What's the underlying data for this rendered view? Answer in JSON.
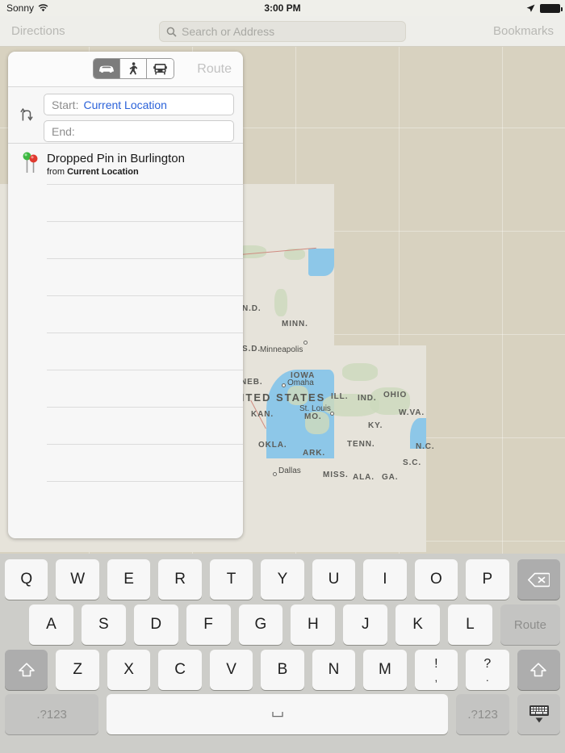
{
  "status_bar": {
    "carrier": "Sonny",
    "wifi_icon": "wifi-icon",
    "time": "3:00 PM",
    "location_icon": "location-arrow-icon",
    "battery_icon": "battery-full-icon"
  },
  "navbar": {
    "directions_label": "Directions",
    "bookmarks_label": "Bookmarks",
    "search_placeholder": "Search or Address",
    "search_value": "",
    "search_icon": "search-icon"
  },
  "panel": {
    "route_label": "Route",
    "modes": [
      {
        "name": "drive-mode",
        "icon": "car-icon",
        "selected": true
      },
      {
        "name": "walk-mode",
        "icon": "walking-icon",
        "selected": false
      },
      {
        "name": "transit-mode",
        "icon": "bus-icon",
        "selected": false
      }
    ],
    "swap_icon": "swap-arrows-icon",
    "start_field": {
      "label": "Start:",
      "value": "Current Location",
      "placeholder": ""
    },
    "end_field": {
      "label": "End:",
      "value": "",
      "placeholder": ""
    },
    "recents": [
      {
        "title": "Dropped Pin in Burlington",
        "sub_prefix": "from ",
        "sub_bold": "Current Location",
        "icon": "map-pins-icon"
      }
    ],
    "empty_row_count": 8
  },
  "map": {
    "base_color": "#d8d2c0",
    "land_color": "#e6e3da",
    "water_color": "#8dc7e8",
    "country_label": "UNITED STATES",
    "state_labels": [
      "N.D.",
      "S.D.",
      "MINN.",
      "NEB.",
      "IOWA",
      "ILL.",
      "IND.",
      "OHIO",
      "KAN.",
      "MO.",
      "KY.",
      "W.VA.",
      "OKLA.",
      "ARK.",
      "TENN.",
      "N.C.",
      "S.C.",
      "MISS.",
      "ALA.",
      "GA."
    ],
    "city_labels": [
      "Minneapolis",
      "Omaha",
      "St. Louis",
      "Dallas"
    ]
  },
  "keyboard": {
    "row1": [
      "Q",
      "W",
      "E",
      "R",
      "T",
      "Y",
      "U",
      "I",
      "O",
      "P"
    ],
    "backspace_icon": "backspace-icon",
    "row2": [
      "A",
      "S",
      "D",
      "F",
      "G",
      "H",
      "J",
      "K",
      "L"
    ],
    "return_label": "Route",
    "row3": [
      "Z",
      "X",
      "C",
      "V",
      "B",
      "N",
      "M"
    ],
    "punct1_top": "!",
    "punct1_bottom": ",",
    "punct2_top": "?",
    "punct2_bottom": ".",
    "shift_icon": "shift-up-icon",
    "numeric_label_left": ".?123",
    "numeric_label_right": ".?123",
    "space_icon": "space-bar-icon",
    "hide_keyboard_icon": "hide-keyboard-icon"
  }
}
